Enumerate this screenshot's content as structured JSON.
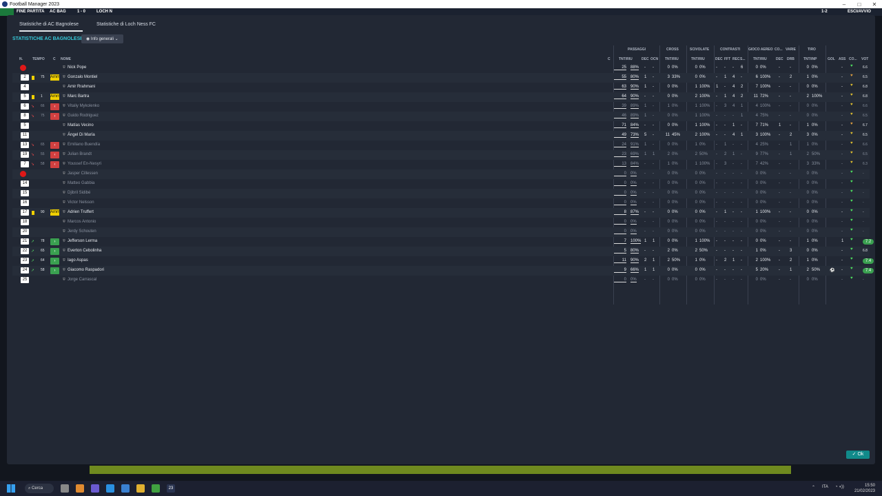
{
  "window": {
    "title": "Football Manager 2023",
    "controls": [
      "–",
      "□",
      "✕"
    ]
  },
  "game_bar": {
    "chip1": "FINE PARTITA",
    "chip2": "AC BAG",
    "chip3": "1 - 0",
    "chip4": "LOCH N",
    "chip5": "1-2",
    "chip6": "ESCI/AVVIO"
  },
  "tabs": [
    "Statistiche di AC Bagnolese",
    "Statistiche di Loch Ness FC"
  ],
  "section_title": "STATISTICHE AC BAGNOLESE",
  "view_dropdown": "Info generali",
  "group_headers": {
    "passaggi": "PASSAGGI",
    "cross": "CROSS",
    "scivolate": "SCIVOLATE",
    "contrasti": "CONTRASTI",
    "gioco_aereo": "GIOCO AEREO",
    "co": "CO...",
    "varie": "VARIE",
    "tiro": "TIRO"
  },
  "columns": {
    "n": "N.",
    "tempo": "TEMPO",
    "c": "C",
    "nome": "NOME",
    "c2": "C",
    "pass_tnt": "TNT/RIU",
    "dec": "DEC",
    "ocn": "OCN",
    "cross_tnt": "TNT/RIU",
    "sciv_tnt": "TNT/RIU",
    "cdec": "DEC",
    "fft": "FFT",
    "rec": "REC",
    "s": "S...",
    "aereo_tnt": "TNT/RIU",
    "adec": "DEC",
    "drb": "DRB",
    "tiro_tnt": "TNT/INP",
    "gol": "GOL",
    "ass": "ASS",
    "co2": "CO...",
    "vot": "VOT"
  },
  "players": [
    {
      "num": "1",
      "tempo": "",
      "role": "sub-red",
      "card": "",
      "name": "Nick Pope",
      "dim": false,
      "p": [
        "25",
        "88%"
      ],
      "pd": "-",
      "po": "-",
      "cr": [
        "0",
        "0%"
      ],
      "sc": [
        "0",
        "0%"
      ],
      "ct": [
        "-",
        "-",
        "-",
        "6"
      ],
      "ga": [
        "0",
        "0%"
      ],
      "ad": "-",
      "drb": "-",
      "ti": [
        "0",
        "0%"
      ],
      "gol": "",
      "ass": "-",
      "heart": "g",
      "vot": "6.6",
      "vpill": false
    },
    {
      "num": "2",
      "tempo": "75",
      "role": "ammo",
      "card": "y",
      "name": "Gonzalo Montiel",
      "dim": false,
      "p": [
        "55",
        "80%"
      ],
      "pd": "1",
      "po": "-",
      "cr": [
        "3",
        "33%"
      ],
      "sc": [
        "0",
        "0%"
      ],
      "ct": [
        "-",
        "1",
        "4",
        "-"
      ],
      "ga": [
        "6",
        "100%"
      ],
      "ad": "-",
      "drb": "2",
      "ti": [
        "1",
        "0%"
      ],
      "gol": "",
      "ass": "-",
      "heart": "o",
      "vot": "6.5",
      "vpill": false
    },
    {
      "num": "4",
      "tempo": "",
      "role": "",
      "card": "",
      "name": "Amir Rrahmani",
      "dim": false,
      "p": [
        "63",
        "90%"
      ],
      "pd": "1",
      "po": "-",
      "cr": [
        "0",
        "0%"
      ],
      "sc": [
        "1",
        "100%"
      ],
      "ct": [
        "1",
        "-",
        "4",
        "2"
      ],
      "ga": [
        "7",
        "100%"
      ],
      "ad": "-",
      "drb": "-",
      "ti": [
        "0",
        "0%"
      ],
      "gol": "",
      "ass": "-",
      "heart": "y",
      "vot": "6.8",
      "vpill": false
    },
    {
      "num": "5",
      "tempo": "1",
      "role": "ammo",
      "card": "y",
      "name": "Marc Bartra",
      "dim": false,
      "p": [
        "64",
        "90%"
      ],
      "pd": "-",
      "po": "-",
      "cr": [
        "0",
        "0%"
      ],
      "sc": [
        "2",
        "100%"
      ],
      "ct": [
        "-",
        "1",
        "4",
        "2"
      ],
      "ga": [
        "11",
        "72%"
      ],
      "ad": "-",
      "drb": "-",
      "ti": [
        "2",
        "100%"
      ],
      "gol": "",
      "ass": "-",
      "heart": "y",
      "vot": "6.8",
      "vpill": false
    },
    {
      "num": "6",
      "tempo": "66",
      "role": "out",
      "card": "out",
      "name": "Vitaliy Mykolenko",
      "dim": true,
      "p": [
        "39",
        "89%"
      ],
      "pd": "1",
      "po": "-",
      "cr": [
        "1",
        "0%"
      ],
      "sc": [
        "1",
        "100%"
      ],
      "ct": [
        "-",
        "3",
        "4",
        "1"
      ],
      "ga": [
        "4",
        "100%"
      ],
      "ad": "-",
      "drb": "-",
      "ti": [
        "0",
        "0%"
      ],
      "gol": "",
      "ass": "-",
      "heart": "y",
      "vot": "6.6",
      "vpill": false
    },
    {
      "num": "8",
      "tempo": "75",
      "role": "out",
      "card": "out",
      "name": "Guido Rodriguez",
      "dim": true,
      "p": [
        "46",
        "89%"
      ],
      "pd": "1",
      "po": "-",
      "cr": [
        "0",
        "0%"
      ],
      "sc": [
        "1",
        "100%"
      ],
      "ct": [
        "-",
        "-",
        "-",
        "1"
      ],
      "ga": [
        "4",
        "75%"
      ],
      "ad": "-",
      "drb": "-",
      "ti": [
        "0",
        "0%"
      ],
      "gol": "",
      "ass": "-",
      "heart": "y",
      "vot": "6.5",
      "vpill": false
    },
    {
      "num": "5",
      "tempo": "",
      "role": "",
      "card": "",
      "name": "Matías Vecino",
      "dim": false,
      "p": [
        "71",
        "84%"
      ],
      "pd": "-",
      "po": "-",
      "cr": [
        "0",
        "0%"
      ],
      "sc": [
        "1",
        "100%"
      ],
      "ct": [
        "-",
        "-",
        "1",
        "-"
      ],
      "ga": [
        "7",
        "71%"
      ],
      "ad": "1",
      "drb": "-",
      "ti": [
        "1",
        "0%"
      ],
      "gol": "",
      "ass": "-",
      "heart": "o",
      "vot": "6.7",
      "vpill": false
    },
    {
      "num": "11",
      "tempo": "",
      "role": "",
      "card": "",
      "name": "Ángel Di María",
      "dim": false,
      "p": [
        "49",
        "73%"
      ],
      "pd": "5",
      "po": "-",
      "cr": [
        "11",
        "45%"
      ],
      "sc": [
        "2",
        "100%"
      ],
      "ct": [
        "-",
        "-",
        "4",
        "1"
      ],
      "ga": [
        "3",
        "100%"
      ],
      "ad": "-",
      "drb": "2",
      "ti": [
        "3",
        "0%"
      ],
      "gol": "",
      "ass": "-",
      "heart": "y",
      "vot": "6.5",
      "vpill": false
    },
    {
      "num": "13",
      "tempo": "65",
      "role": "out",
      "card": "out",
      "name": "Emiliano Buendía",
      "dim": true,
      "p": [
        "24",
        "91%"
      ],
      "pd": "1",
      "po": "-",
      "cr": [
        "0",
        "0%"
      ],
      "sc": [
        "1",
        "0%"
      ],
      "ct": [
        "-",
        "1",
        "-",
        "-"
      ],
      "ga": [
        "4",
        "25%"
      ],
      "ad": "-",
      "drb": "1",
      "ti": [
        "1",
        "0%"
      ],
      "gol": "",
      "ass": "-",
      "heart": "y",
      "vot": "6.6",
      "vpill": false
    },
    {
      "num": "19",
      "tempo": "55",
      "role": "out",
      "card": "out",
      "name": "Julian Brandt",
      "dim": true,
      "p": [
        "23",
        "69%"
      ],
      "pd": "1",
      "po": "1",
      "cr": [
        "2",
        "0%"
      ],
      "sc": [
        "2",
        "50%"
      ],
      "ct": [
        "-",
        "2",
        "1",
        "-"
      ],
      "ga": [
        "9",
        "77%"
      ],
      "ad": "-",
      "drb": "1",
      "ti": [
        "2",
        "50%"
      ],
      "gol": "",
      "ass": "-",
      "heart": "y",
      "vot": "6.5",
      "vpill": false
    },
    {
      "num": "7",
      "tempo": "58",
      "role": "out",
      "card": "out",
      "name": "Youssef En-Nesyri",
      "dim": true,
      "p": [
        "13",
        "84%"
      ],
      "pd": "-",
      "po": "-",
      "cr": [
        "1",
        "0%"
      ],
      "sc": [
        "1",
        "100%"
      ],
      "ct": [
        "-",
        "3",
        "-",
        "-"
      ],
      "ga": [
        "7",
        "42%"
      ],
      "ad": "-",
      "drb": "-",
      "ti": [
        "3",
        "33%"
      ],
      "gol": "",
      "ass": "-",
      "heart": "y",
      "vot": "6.3",
      "vpill": false
    },
    {
      "num": "12",
      "tempo": "",
      "role": "sub-red",
      "card": "",
      "name": "Jasper Cillessen",
      "dim": true,
      "p": [
        "0",
        "0%"
      ],
      "pd": "-",
      "po": "-",
      "cr": [
        "0",
        "0%"
      ],
      "sc": [
        "0",
        "0%"
      ],
      "ct": [
        "-",
        "-",
        "-",
        "-"
      ],
      "ga": [
        "0",
        "0%"
      ],
      "ad": "-",
      "drb": "-",
      "ti": [
        "0",
        "0%"
      ],
      "gol": "",
      "ass": "-",
      "heart": "g",
      "vot": "-",
      "vpill": false
    },
    {
      "num": "14",
      "tempo": "",
      "role": "",
      "card": "",
      "name": "Matteo Gabbia",
      "dim": true,
      "p": [
        "0",
        "0%"
      ],
      "pd": "-",
      "po": "-",
      "cr": [
        "0",
        "0%"
      ],
      "sc": [
        "0",
        "0%"
      ],
      "ct": [
        "-",
        "-",
        "-",
        "-"
      ],
      "ga": [
        "0",
        "0%"
      ],
      "ad": "-",
      "drb": "-",
      "ti": [
        "0",
        "0%"
      ],
      "gol": "",
      "ass": "-",
      "heart": "g",
      "vot": "-",
      "vpill": false
    },
    {
      "num": "15",
      "tempo": "",
      "role": "",
      "card": "",
      "name": "Djibril Sidibé",
      "dim": true,
      "p": [
        "0",
        "0%"
      ],
      "pd": "-",
      "po": "-",
      "cr": [
        "0",
        "0%"
      ],
      "sc": [
        "0",
        "0%"
      ],
      "ct": [
        "-",
        "-",
        "-",
        "-"
      ],
      "ga": [
        "0",
        "0%"
      ],
      "ad": "-",
      "drb": "-",
      "ti": [
        "0",
        "0%"
      ],
      "gol": "",
      "ass": "-",
      "heart": "g",
      "vot": "-",
      "vpill": false
    },
    {
      "num": "16",
      "tempo": "",
      "role": "",
      "card": "",
      "name": "Victor Nelsson",
      "dim": true,
      "p": [
        "0",
        "0%"
      ],
      "pd": "-",
      "po": "-",
      "cr": [
        "0",
        "0%"
      ],
      "sc": [
        "0",
        "0%"
      ],
      "ct": [
        "-",
        "-",
        "-",
        "-"
      ],
      "ga": [
        "0",
        "0%"
      ],
      "ad": "-",
      "drb": "-",
      "ti": [
        "0",
        "0%"
      ],
      "gol": "",
      "ass": "-",
      "heart": "g",
      "vot": "-",
      "vpill": false
    },
    {
      "num": "17",
      "tempo": "90",
      "role": "ammo",
      "card": "y",
      "name": "Adrien Truffert",
      "dim": false,
      "p": [
        "8",
        "87%"
      ],
      "pd": "-",
      "po": "-",
      "cr": [
        "0",
        "0%"
      ],
      "sc": [
        "0",
        "0%"
      ],
      "ct": [
        "-",
        "1",
        "-",
        "-"
      ],
      "ga": [
        "1",
        "100%"
      ],
      "ad": "-",
      "drb": "-",
      "ti": [
        "0",
        "0%"
      ],
      "gol": "",
      "ass": "-",
      "heart": "g",
      "vot": "-",
      "vpill": false
    },
    {
      "num": "18",
      "tempo": "",
      "role": "",
      "card": "",
      "name": "Marcos Antonio",
      "dim": true,
      "p": [
        "0",
        "0%"
      ],
      "pd": "-",
      "po": "-",
      "cr": [
        "0",
        "0%"
      ],
      "sc": [
        "0",
        "0%"
      ],
      "ct": [
        "-",
        "-",
        "-",
        "-"
      ],
      "ga": [
        "0",
        "0%"
      ],
      "ad": "-",
      "drb": "-",
      "ti": [
        "0",
        "0%"
      ],
      "gol": "",
      "ass": "-",
      "heart": "g",
      "vot": "-",
      "vpill": false
    },
    {
      "num": "20",
      "tempo": "",
      "role": "",
      "card": "",
      "name": "Jerdy Schouten",
      "dim": true,
      "p": [
        "0",
        "0%"
      ],
      "pd": "-",
      "po": "-",
      "cr": [
        "0",
        "0%"
      ],
      "sc": [
        "0",
        "0%"
      ],
      "ct": [
        "-",
        "-",
        "-",
        "-"
      ],
      "ga": [
        "0",
        "0%"
      ],
      "ad": "-",
      "drb": "-",
      "ti": [
        "0",
        "0%"
      ],
      "gol": "",
      "ass": "-",
      "heart": "g",
      "vot": "-",
      "vpill": false
    },
    {
      "num": "21",
      "tempo": "78",
      "role": "in",
      "card": "in",
      "name": "Jefferson Lerma",
      "dim": false,
      "p": [
        "7",
        "100%"
      ],
      "pd": "1",
      "po": "1",
      "cr": [
        "0",
        "0%"
      ],
      "sc": [
        "1",
        "100%"
      ],
      "ct": [
        "-",
        "-",
        "-",
        "-"
      ],
      "ga": [
        "0",
        "0%"
      ],
      "ad": "-",
      "drb": "-",
      "ti": [
        "1",
        "0%"
      ],
      "gol": "",
      "ass": "1",
      "heart": "g",
      "vot": "7.2",
      "vpill": true
    },
    {
      "num": "22",
      "tempo": "65",
      "role": "in",
      "card": "in",
      "name": "Everton Cebolinha",
      "dim": false,
      "p": [
        "5",
        "80%"
      ],
      "pd": "-",
      "po": "-",
      "cr": [
        "2",
        "0%"
      ],
      "sc": [
        "2",
        "50%"
      ],
      "ct": [
        "-",
        "-",
        "-",
        "-"
      ],
      "ga": [
        "1",
        "0%"
      ],
      "ad": "-",
      "drb": "3",
      "ti": [
        "0",
        "0%"
      ],
      "gol": "",
      "ass": "-",
      "heart": "g",
      "vot": "6.8",
      "vpill": false
    },
    {
      "num": "23",
      "tempo": "64",
      "role": "in",
      "card": "in",
      "name": "Iago Aspas",
      "dim": false,
      "p": [
        "11",
        "90%"
      ],
      "pd": "2",
      "po": "1",
      "cr": [
        "2",
        "50%"
      ],
      "sc": [
        "1",
        "0%"
      ],
      "ct": [
        "-",
        "2",
        "1",
        "-"
      ],
      "ga": [
        "2",
        "100%"
      ],
      "ad": "-",
      "drb": "2",
      "ti": [
        "1",
        "0%"
      ],
      "gol": "",
      "ass": "-",
      "heart": "g",
      "vot": "7.4",
      "vpill": true
    },
    {
      "num": "24",
      "tempo": "58",
      "role": "in",
      "card": "in",
      "name": "Giacomo Raspadori",
      "dim": false,
      "p": [
        "9",
        "66%"
      ],
      "pd": "1",
      "po": "1",
      "cr": [
        "0",
        "0%"
      ],
      "sc": [
        "0",
        "0%"
      ],
      "ct": [
        "-",
        "-",
        "-",
        "-"
      ],
      "ga": [
        "5",
        "20%"
      ],
      "ad": "-",
      "drb": "1",
      "ti": [
        "2",
        "50%"
      ],
      "gol": "⚽",
      "ass": "-",
      "heart": "g",
      "vot": "7.4",
      "vpill": true
    },
    {
      "num": "25",
      "tempo": "",
      "role": "",
      "card": "",
      "name": "Jorge Carrascal",
      "dim": true,
      "p": [
        "0",
        "0%"
      ],
      "pd": "-",
      "po": "-",
      "cr": [
        "0",
        "0%"
      ],
      "sc": [
        "0",
        "0%"
      ],
      "ct": [
        "-",
        "-",
        "-",
        "-"
      ],
      "ga": [
        "0",
        "0%"
      ],
      "ad": "-",
      "drb": "-",
      "ti": [
        "0",
        "0%"
      ],
      "gol": "",
      "ass": "-",
      "heart": "g",
      "vot": "-",
      "vpill": false
    }
  ],
  "ok_button": "Ok",
  "taskbar": {
    "search": "Cerca",
    "badge": "23",
    "lang": "ITA",
    "time": "15:50",
    "date": "21/02/2023"
  }
}
